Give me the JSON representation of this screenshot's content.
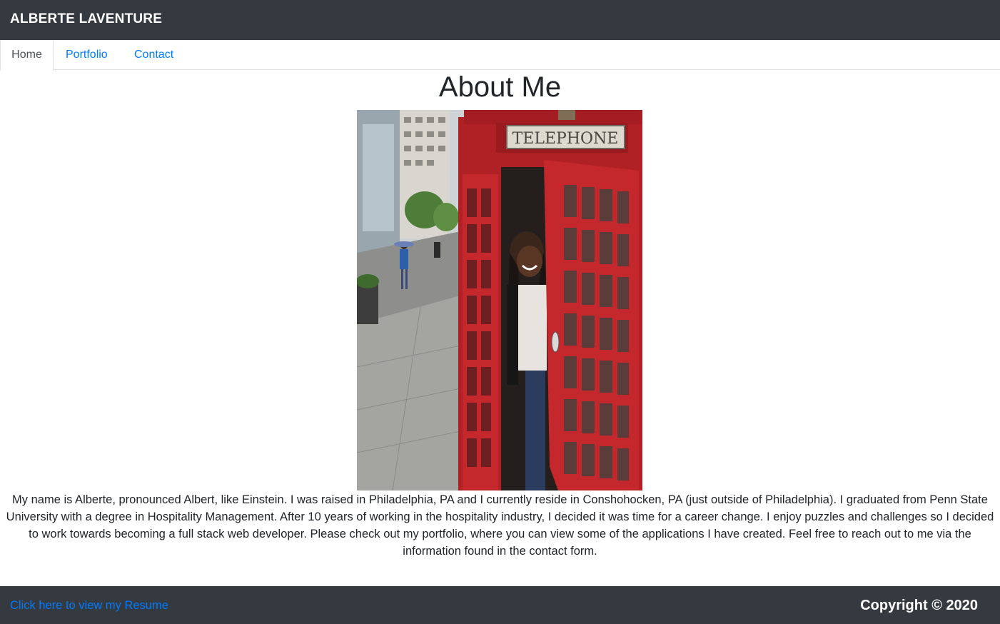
{
  "header": {
    "brand": "ALBERTE LAVENTURE"
  },
  "nav": {
    "tabs": [
      {
        "label": "Home",
        "active": true
      },
      {
        "label": "Portfolio",
        "active": false
      },
      {
        "label": "Contact",
        "active": false
      }
    ]
  },
  "main": {
    "title": "About Me",
    "photo_sign": "TELEPHONE",
    "bio": "My name is Alberte, pronounced Albert, like Einstein. I was raised in Philadelphia, PA and I currently reside in Conshohocken, PA (just outside of Philadelphia). I graduated from Penn State University with a degree in Hospitality Management. After 10 years of working in the hospitality industry, I decided it was time for a career change. I enjoy puzzles and challenges so I decided to work towards becoming a full stack web developer. Please check out my portfolio, where you can view some of the applications I have created. Feel free to reach out to me via the information found in the contact form."
  },
  "footer": {
    "resume_link": "Click here to view my Resume",
    "copyright": "Copyright © 2020"
  },
  "colors": {
    "navbar": "#343a40",
    "link": "#007bff",
    "booth_red": "#c4282c"
  }
}
